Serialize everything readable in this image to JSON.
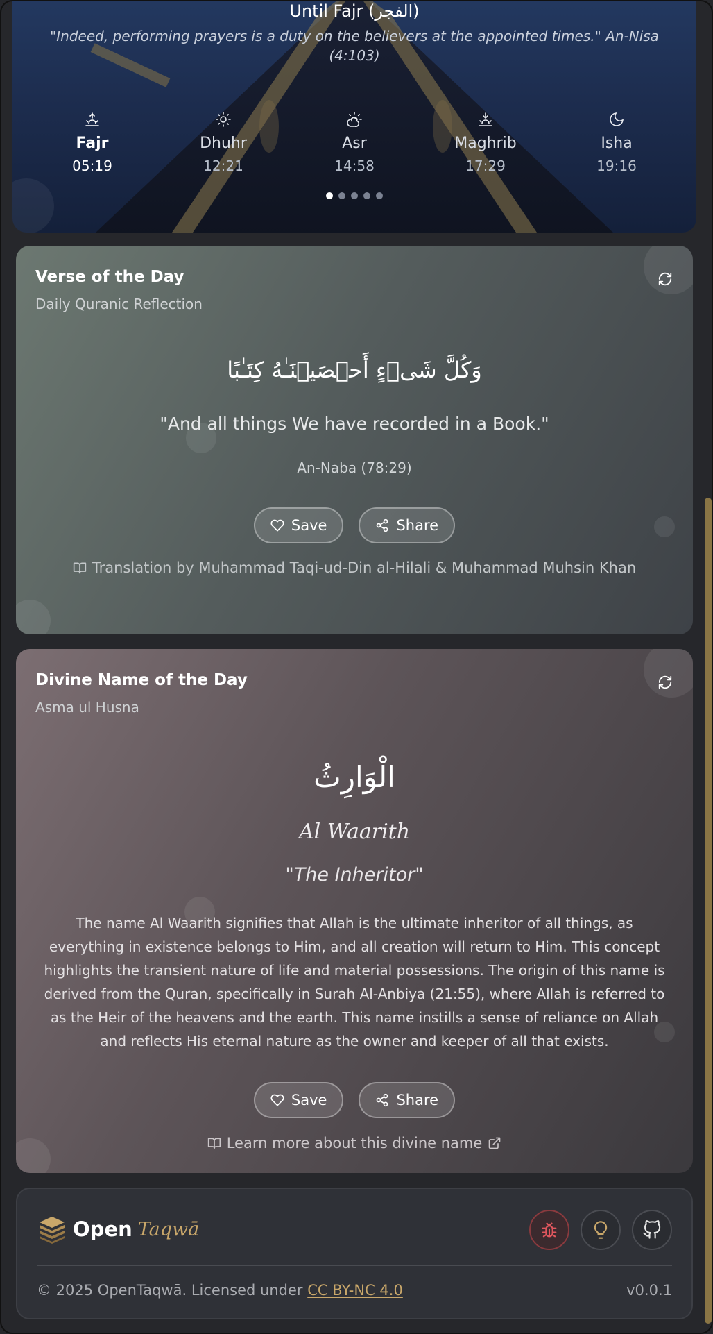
{
  "hero": {
    "title": "Until Fajr (الفجر)",
    "quote": "\"Indeed, performing prayers is a duty on the believers at the appointed times.\" An-Nisa (4:103)",
    "prayers": [
      {
        "name": "Fajr",
        "time": "05:19",
        "icon": "sunrise-icon",
        "active": true
      },
      {
        "name": "Dhuhr",
        "time": "12:21",
        "icon": "sun-icon",
        "active": false
      },
      {
        "name": "Asr",
        "time": "14:58",
        "icon": "cloud-sun-icon",
        "active": false
      },
      {
        "name": "Maghrib",
        "time": "17:29",
        "icon": "sunset-icon",
        "active": false
      },
      {
        "name": "Isha",
        "time": "19:16",
        "icon": "moon-icon",
        "active": false
      }
    ],
    "pager": {
      "count": 5,
      "current": 1
    }
  },
  "verse_card": {
    "title": "Verse of the Day",
    "subtitle": "Daily Quranic Reflection",
    "arabic": "وَكُلَّ شَىۡءٍ أَحۡصَيۡنَـٰهُ كِتَـٰبًا",
    "translation": "\"And all things We have recorded in a Book.\"",
    "reference": "An-Naba (78:29)",
    "save_label": "Save",
    "share_label": "Share",
    "credit": "Translation by Muhammad Taqi-ud-Din al-Hilali & Muhammad Muhsin Khan"
  },
  "name_card": {
    "title": "Divine Name of the Day",
    "subtitle": "Asma ul Husna",
    "arabic": "الْوَارِثُ",
    "latin": "Al Waarith",
    "meaning": "\"The Inheritor\"",
    "description": "The name Al Waarith signifies that Allah is the ultimate inheritor of all things, as everything in existence belongs to Him, and all creation will return to Him. This concept highlights the transient nature of life and material possessions. The origin of this name is derived from the Quran, specifically in Surah Al-Anbiya (21:55), where Allah is referred to as the Heir of the heavens and the earth. This name instills a sense of reliance on Allah and reflects His eternal nature as the owner and keeper of all that exists.",
    "save_label": "Save",
    "share_label": "Share",
    "learn_more": "Learn more about this divine name"
  },
  "footer": {
    "logo_open": "Open",
    "logo_taqwa": "Taqwā",
    "copyright": "© 2025 OpenTaqwā. Licensed under",
    "license": "CC BY-NC 4.0",
    "version": "v0.0.1",
    "icons": [
      "bug-icon",
      "lightbulb-icon",
      "github-icon"
    ]
  },
  "colors": {
    "accent_gold": "#c9a76a",
    "bug_red": "#e0575e"
  }
}
